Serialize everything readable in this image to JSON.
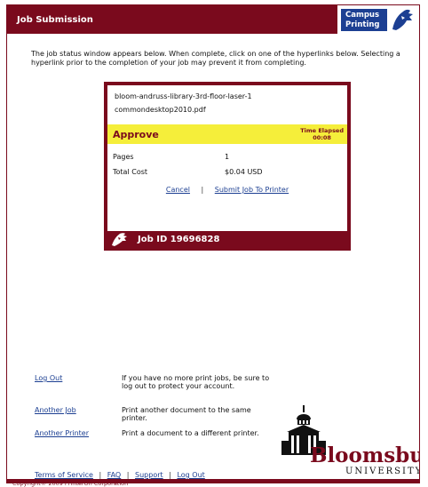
{
  "header": {
    "title": "Job Submission",
    "logo_line1": "Campus",
    "logo_line2": "Printing"
  },
  "intro": {
    "text": "The job status window appears below. When complete, click on one of the hyperlinks below. Selecting a hyperlink prior to the completion of your job may prevent it from completing."
  },
  "job": {
    "printer": "bloom-andruss-library-3rd-floor-laser-1",
    "document": "commondesktop2010.pdf",
    "status": "Approve",
    "time_label": "Time Elapsed",
    "time_value": "00:08",
    "pages_label": "Pages",
    "pages_value": "1",
    "cost_label": "Total Cost",
    "cost_value": "$0.04 USD",
    "cancel_link": "Cancel",
    "link_separator": "|",
    "submit_link": "Submit Job To Printer",
    "job_id_label": "Job ID  19696828"
  },
  "options": [
    {
      "link": "Log Out",
      "description": "If you have no more print jobs, be sure to log out to protect your account."
    },
    {
      "link": "Another Job",
      "description": "Print another document to the same printer."
    },
    {
      "link": "Another Printer",
      "description": "Print a document to a different printer."
    }
  ],
  "university": {
    "name": "Bloomsburg",
    "subtitle": "UNIVERSITY"
  },
  "footer": {
    "links": [
      "Terms of Service",
      "FAQ",
      "Support",
      "Log Out"
    ],
    "separator": "|",
    "copyright": "Copyright© 2009 PrinterOn Corporation"
  },
  "colors": {
    "brand": "#7a0a1d",
    "band": "#f5ee3a",
    "link": "#1c3f92"
  }
}
